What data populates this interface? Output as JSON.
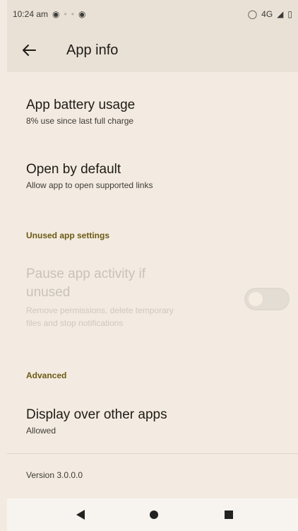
{
  "status_bar": {
    "time": "10:24 am",
    "network": "4G"
  },
  "app_bar": {
    "title": "App info"
  },
  "items": {
    "battery": {
      "title": "App battery usage",
      "subtitle": "8% use since last full charge"
    },
    "open_default": {
      "title": "Open by default",
      "subtitle": "Allow app to open supported links"
    },
    "pause_activity": {
      "title_line1": "Pause app activity if",
      "title_line2": "unused",
      "subtitle_line1": "Remove permissions, delete temporary",
      "subtitle_line2": "files and stop notifications",
      "enabled": false,
      "toggle_on": false
    },
    "display_over": {
      "title": "Display over other apps",
      "subtitle": "Allowed"
    }
  },
  "sections": {
    "unused": "Unused app settings",
    "advanced": "Advanced"
  },
  "footer": {
    "version": "Version 3.0.0.0"
  },
  "colors": {
    "background": "#f3ebe1",
    "header_bg": "#e9e1d6",
    "section_text": "#6b5a14",
    "disabled_text": "#c9c2b8"
  },
  "icons": [
    "wifi-icon",
    "signal-icon",
    "battery-icon",
    "back-arrow-icon",
    "nav-back-icon",
    "nav-home-icon",
    "nav-recents-icon"
  ]
}
